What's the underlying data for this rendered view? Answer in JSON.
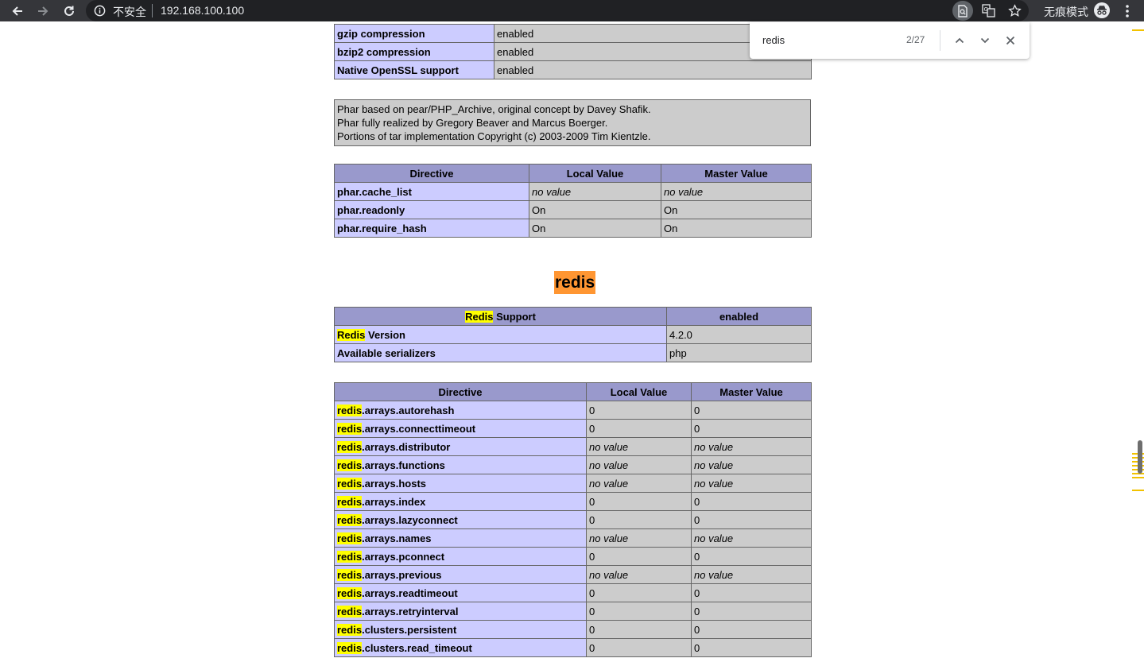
{
  "browser": {
    "security_label": "不安全",
    "url": "192.168.100.100",
    "incognito_label": "无痕模式"
  },
  "find_bar": {
    "query": "redis",
    "count": "2/27"
  },
  "phar_top_rows": [
    {
      "name": "gzip compression",
      "value": "enabled"
    },
    {
      "name": "bzip2 compression",
      "value": "enabled"
    },
    {
      "name": "Native OpenSSL support",
      "value": "enabled"
    }
  ],
  "phar_credits": [
    "Phar based on pear/PHP_Archive, original concept by Davey Shafik.",
    "Phar fully realized by Gregory Beaver and Marcus Boerger.",
    "Portions of tar implementation Copyright (c) 2003-2009 Tim Kientzle."
  ],
  "phar_directives": {
    "headers": [
      "Directive",
      "Local Value",
      "Master Value"
    ],
    "rows": [
      {
        "name": "phar.cache_list",
        "local": "no value",
        "master": "no value"
      },
      {
        "name": "phar.readonly",
        "local": "On",
        "master": "On"
      },
      {
        "name": "phar.require_hash",
        "local": "On",
        "master": "On"
      }
    ]
  },
  "redis_section": {
    "title": "redis",
    "support": {
      "header_name_hl": "Redis",
      "header_name_rest": " Support",
      "header_value": "enabled",
      "rows": [
        {
          "name_hl": "Redis",
          "name_rest": " Version",
          "value": "4.2.0"
        },
        {
          "name_hl": "",
          "name_rest": "Available serializers",
          "value": "php"
        }
      ]
    },
    "directives": {
      "headers": [
        "Directive",
        "Local Value",
        "Master Value"
      ],
      "rows": [
        {
          "prefix": "redis",
          "name": ".arrays.autorehash",
          "local": "0",
          "master": "0"
        },
        {
          "prefix": "redis",
          "name": ".arrays.connecttimeout",
          "local": "0",
          "master": "0"
        },
        {
          "prefix": "redis",
          "name": ".arrays.distributor",
          "local": "no value",
          "master": "no value"
        },
        {
          "prefix": "redis",
          "name": ".arrays.functions",
          "local": "no value",
          "master": "no value"
        },
        {
          "prefix": "redis",
          "name": ".arrays.hosts",
          "local": "no value",
          "master": "no value"
        },
        {
          "prefix": "redis",
          "name": ".arrays.index",
          "local": "0",
          "master": "0"
        },
        {
          "prefix": "redis",
          "name": ".arrays.lazyconnect",
          "local": "0",
          "master": "0"
        },
        {
          "prefix": "redis",
          "name": ".arrays.names",
          "local": "no value",
          "master": "no value"
        },
        {
          "prefix": "redis",
          "name": ".arrays.pconnect",
          "local": "0",
          "master": "0"
        },
        {
          "prefix": "redis",
          "name": ".arrays.previous",
          "local": "no value",
          "master": "no value"
        },
        {
          "prefix": "redis",
          "name": ".arrays.readtimeout",
          "local": "0",
          "master": "0"
        },
        {
          "prefix": "redis",
          "name": ".arrays.retryinterval",
          "local": "0",
          "master": "0"
        },
        {
          "prefix": "redis",
          "name": ".clusters.persistent",
          "local": "0",
          "master": "0"
        },
        {
          "prefix": "redis",
          "name": ".clusters.read_timeout",
          "local": "0",
          "master": "0"
        }
      ]
    }
  },
  "colors": {
    "header_bg": "#9999cc",
    "name_cell_bg": "#ccccff",
    "value_cell_bg": "#cccccc",
    "match_highlight": "#ffff00",
    "active_match": "#ff9632",
    "toolbar_bg": "#35363a"
  },
  "icons": [
    "back-arrow-icon",
    "forward-arrow-icon",
    "reload-icon",
    "info-icon",
    "find-in-page-icon",
    "translate-icon",
    "star-icon",
    "incognito-icon",
    "more-vert-icon",
    "chevron-up-icon",
    "chevron-down-icon",
    "close-icon"
  ]
}
